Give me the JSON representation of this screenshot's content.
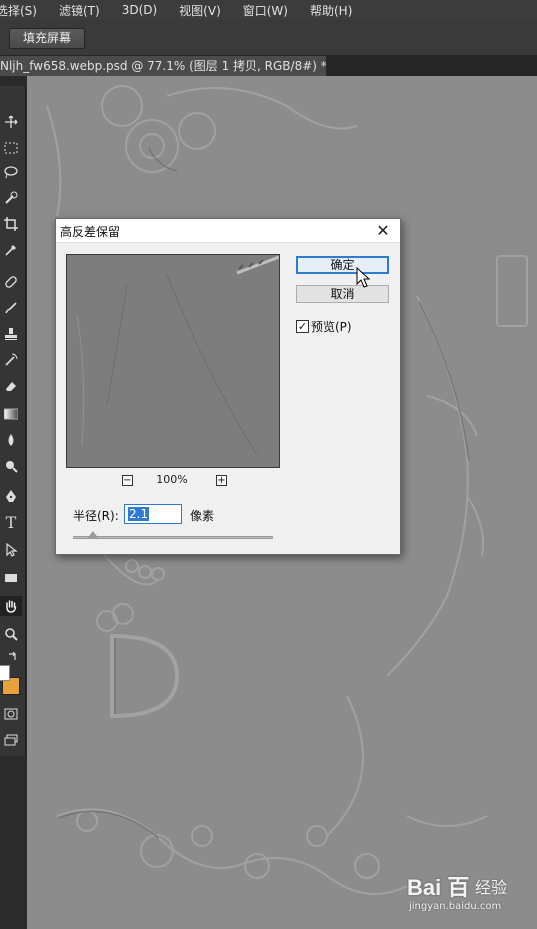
{
  "menu": [
    "选择(S)",
    "滤镜(T)",
    "3D(D)",
    "视图(V)",
    "窗口(W)",
    "帮助(H)"
  ],
  "options_bar": {
    "fill_screen_button": "填充屏幕"
  },
  "document_tab": {
    "title": "Nljh_fw658.webp.psd @ 77.1% (图层 1 拷贝, RGB/8#) *",
    "close": "×"
  },
  "dialog": {
    "title": "高反差保留",
    "close": "✕",
    "ok_label": "确定",
    "cancel_label": "取消",
    "preview_label": "预览(P)",
    "preview_checked": true,
    "zoom_level": "100%",
    "zoom_minus": "−",
    "zoom_plus": "+",
    "radius_label": "半径(R):",
    "radius_value": "2.1",
    "unit_label": "像素",
    "slider_fraction": 0.1
  },
  "toolbar_icons": [
    "move-icon",
    "marquee-icon",
    "lasso-icon",
    "quick-select-icon",
    "crop-icon",
    "eyedropper-icon",
    "healing-brush-icon",
    "brush-icon",
    "clone-stamp-icon",
    "history-brush-icon",
    "eraser-icon",
    "gradient-icon",
    "blur-icon",
    "dodge-icon",
    "pen-icon",
    "type-icon",
    "path-select-icon",
    "rectangle-icon",
    "hand-icon",
    "zoom-icon"
  ],
  "type_tool_glyph": "T",
  "colors": {
    "foreground": "#ffffff",
    "background": "#e8a23c",
    "accent": "#2f7bd1"
  },
  "watermark": {
    "logo": "Bai 百",
    "text": "经验",
    "url": "jingyan.baidu.com"
  }
}
